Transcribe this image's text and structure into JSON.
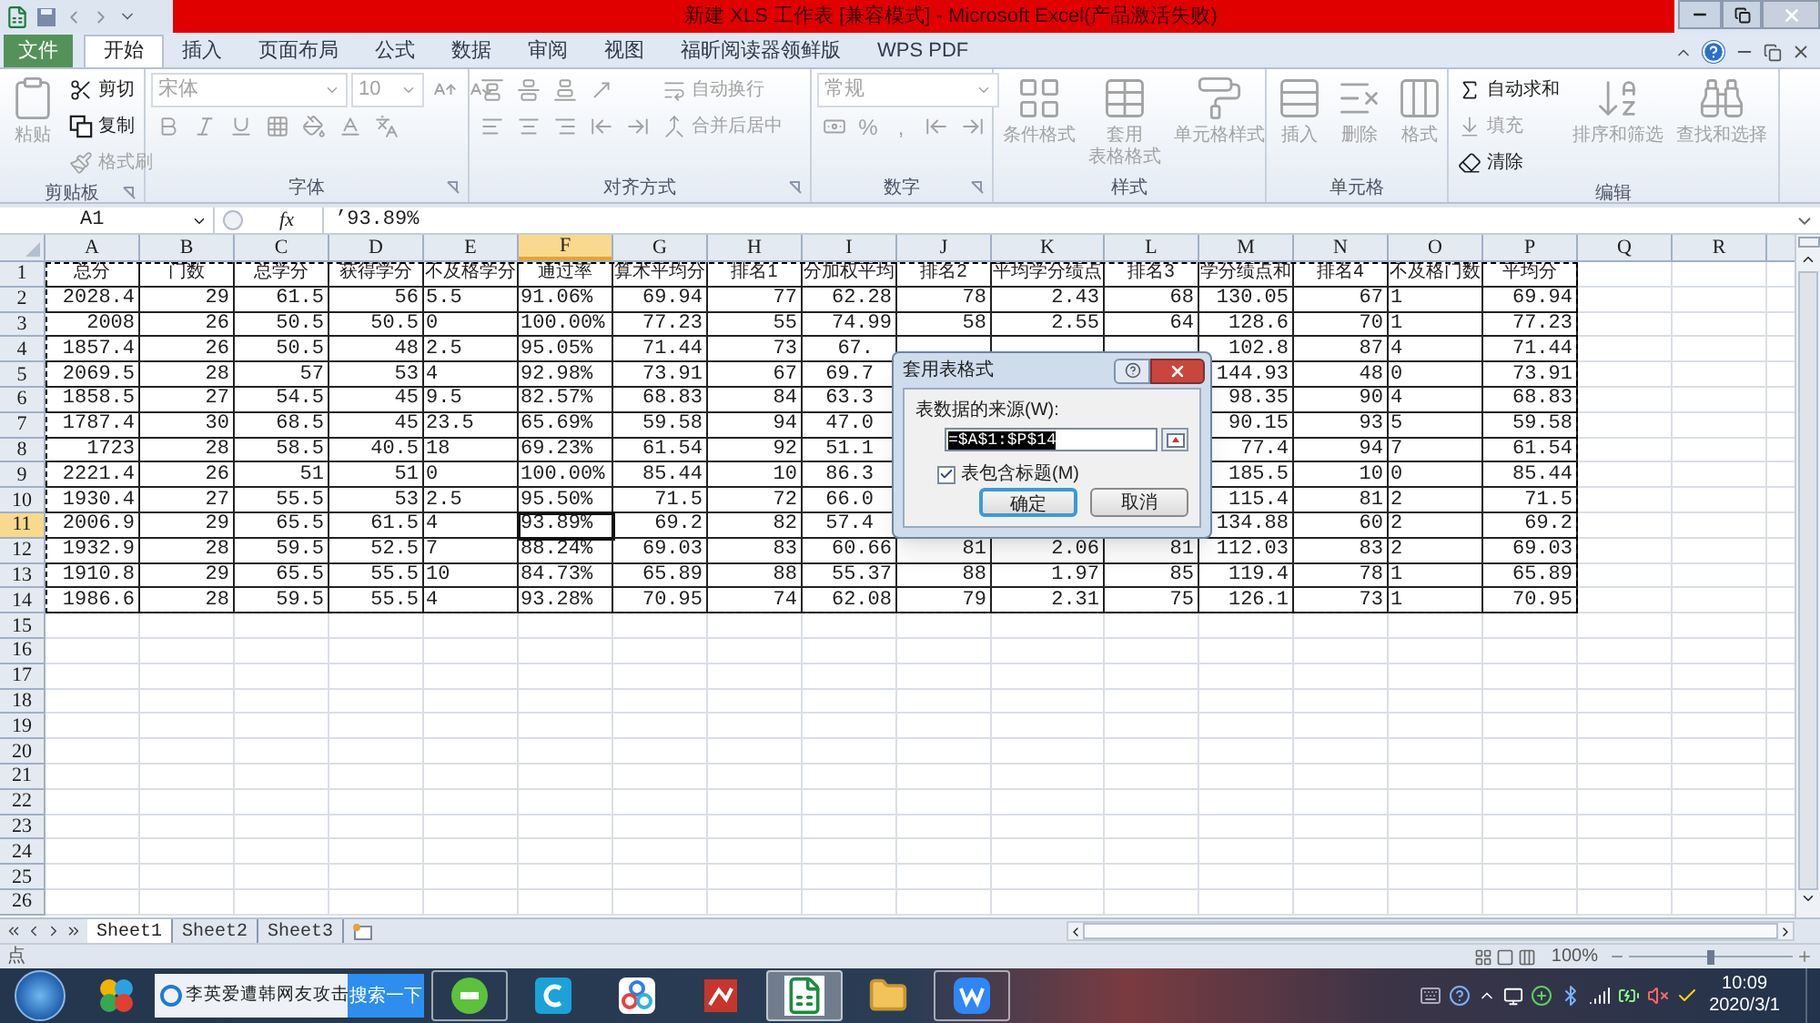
{
  "window": {
    "title": "新建 XLS 工作表 [兼容模式] - Microsoft Excel(产品激活失败)"
  },
  "ribbon": {
    "tabs": [
      {
        "label": "文件",
        "kind": "file",
        "selected": false
      },
      {
        "label": "开始",
        "kind": "tab",
        "selected": true
      },
      {
        "label": "插入",
        "kind": "tab",
        "selected": false
      },
      {
        "label": "页面布局",
        "kind": "tab",
        "selected": false
      },
      {
        "label": "公式",
        "kind": "tab",
        "selected": false
      },
      {
        "label": "数据",
        "kind": "tab",
        "selected": false
      },
      {
        "label": "审阅",
        "kind": "tab",
        "selected": false
      },
      {
        "label": "视图",
        "kind": "tab",
        "selected": false
      },
      {
        "label": "福昕阅读器领鲜版",
        "kind": "tab",
        "selected": false
      },
      {
        "label": "WPS PDF",
        "kind": "tab",
        "selected": false
      }
    ],
    "groups": [
      {
        "title": "剪贴板",
        "launcher": true,
        "columns": [
          {
            "rows": [
              [
                {
                  "kind": "large",
                  "label": "粘贴",
                  "disabled": true
                }
              ]
            ]
          },
          {
            "rows": [
              [
                {
                  "kind": "small",
                  "label": "剪切",
                  "disabled": false
                }
              ],
              [
                {
                  "kind": "small",
                  "label": "复制",
                  "disabled": false
                }
              ],
              [
                {
                  "kind": "small",
                  "label": "格式刷",
                  "disabled": true
                }
              ]
            ]
          }
        ]
      },
      {
        "title": "字体",
        "launcher": true,
        "columns": [
          {
            "rows": [
              [
                {
                  "kind": "combo",
                  "placeholder": "宋体",
                  "disabled": true
                },
                {
                  "kind": "combo",
                  "placeholder": "10",
                  "disabled": true
                },
                {
                  "kind": "icon",
                  "disabled": true
                },
                {
                  "kind": "icon",
                  "disabled": true
                }
              ],
              [
                {
                  "kind": "icon",
                  "disabled": true
                },
                {
                  "kind": "icon",
                  "disabled": true
                },
                {
                  "kind": "icon",
                  "disabled": true
                },
                {
                  "kind": "icon",
                  "disabled": true
                },
                {
                  "kind": "icon",
                  "disabled": true
                },
                {
                  "kind": "icon",
                  "disabled": true
                },
                {
                  "kind": "icon",
                  "disabled": true
                }
              ]
            ]
          }
        ]
      },
      {
        "title": "对齐方式",
        "launcher": true,
        "columns": [
          {
            "rows": [
              [
                {
                  "kind": "icon",
                  "disabled": true
                },
                {
                  "kind": "icon",
                  "disabled": true
                },
                {
                  "kind": "icon",
                  "disabled": true
                },
                {
                  "kind": "icon",
                  "disabled": true
                }
              ],
              [
                {
                  "kind": "icon",
                  "disabled": true
                },
                {
                  "kind": "icon",
                  "disabled": true
                },
                {
                  "kind": "icon",
                  "disabled": true
                },
                {
                  "kind": "icon",
                  "disabled": true
                },
                {
                  "kind": "icon",
                  "disabled": true
                }
              ]
            ]
          },
          {
            "rows": [
              [
                {
                  "kind": "small",
                  "label": "自动换行",
                  "disabled": true
                }
              ],
              [
                {
                  "kind": "small",
                  "label": "合并后居中",
                  "disabled": true
                }
              ]
            ]
          }
        ]
      },
      {
        "title": "数字",
        "launcher": true,
        "columns": [
          {
            "rows": [
              [
                {
                  "kind": "combo",
                  "placeholder": "常规",
                  "disabled": true
                }
              ],
              [
                {
                  "kind": "icon",
                  "disabled": true
                },
                {
                  "kind": "glyph",
                  "label": "%",
                  "disabled": true
                },
                {
                  "kind": "glyph",
                  "label": ",",
                  "disabled": true
                },
                {
                  "kind": "icon",
                  "disabled": true
                },
                {
                  "kind": "icon",
                  "disabled": true
                }
              ]
            ]
          }
        ]
      },
      {
        "title": "样式",
        "launcher": false,
        "columns": [
          {
            "rows": [
              [
                {
                  "kind": "large",
                  "label": "条件格式",
                  "disabled": true
                }
              ]
            ]
          },
          {
            "rows": [
              [
                {
                  "kind": "large",
                  "lines": [
                    "套用",
                    "表格格式"
                  ],
                  "disabled": true
                }
              ]
            ]
          },
          {
            "rows": [
              [
                {
                  "kind": "large",
                  "label": "单元格样式",
                  "disabled": true
                }
              ]
            ]
          }
        ]
      },
      {
        "title": "单元格",
        "launcher": false,
        "columns": [
          {
            "rows": [
              [
                {
                  "kind": "large",
                  "label": "插入",
                  "disabled": true
                }
              ]
            ]
          },
          {
            "rows": [
              [
                {
                  "kind": "large",
                  "label": "删除",
                  "disabled": true
                }
              ]
            ]
          },
          {
            "rows": [
              [
                {
                  "kind": "large",
                  "label": "格式",
                  "disabled": true
                }
              ]
            ]
          }
        ]
      },
      {
        "title": "编辑",
        "launcher": false,
        "columns": [
          {
            "rows": [
              [
                {
                  "kind": "small",
                  "label": "自动求和",
                  "disabled": false
                }
              ],
              [
                {
                  "kind": "small",
                  "label": "填充",
                  "disabled": true
                }
              ],
              [
                {
                  "kind": "small",
                  "label": "清除",
                  "disabled": false
                }
              ]
            ]
          },
          {
            "rows": [
              [
                {
                  "kind": "large",
                  "label": "排序和筛选",
                  "disabled": true
                }
              ]
            ]
          },
          {
            "rows": [
              [
                {
                  "kind": "large",
                  "label": "查找和选择",
                  "disabled": true
                }
              ]
            ]
          }
        ]
      }
    ]
  },
  "formula_bar": {
    "name_box": "A1",
    "fx": "fx",
    "formula": "’93.89%"
  },
  "sheet": {
    "copy_marquee": true,
    "columns": [
      {
        "letter": "A",
        "left_aligned": false,
        "selected": false
      },
      {
        "letter": "B",
        "left_aligned": false,
        "selected": false
      },
      {
        "letter": "C",
        "left_aligned": false,
        "selected": false
      },
      {
        "letter": "D",
        "left_aligned": false,
        "selected": false
      },
      {
        "letter": "E",
        "left_aligned": true,
        "selected": false
      },
      {
        "letter": "F",
        "left_aligned": true,
        "selected": true
      },
      {
        "letter": "G",
        "left_aligned": false,
        "selected": false
      },
      {
        "letter": "H",
        "left_aligned": false,
        "selected": false
      },
      {
        "letter": "I",
        "left_aligned": false,
        "selected": false
      },
      {
        "letter": "J",
        "left_aligned": false,
        "selected": false
      },
      {
        "letter": "K",
        "left_aligned": false,
        "selected": false
      },
      {
        "letter": "L",
        "left_aligned": false,
        "selected": false
      },
      {
        "letter": "M",
        "left_aligned": false,
        "selected": false
      },
      {
        "letter": "N",
        "left_aligned": false,
        "selected": false
      },
      {
        "letter": "O",
        "left_aligned": true,
        "selected": false
      },
      {
        "letter": "P",
        "left_aligned": false,
        "selected": false
      },
      {
        "letter": "Q",
        "selected": false
      },
      {
        "letter": "R",
        "selected": false
      }
    ],
    "rows": [
      {
        "header": "1",
        "kind": "heading",
        "selected": false,
        "cells": [
          "总分",
          "门数",
          "总学分",
          "获得学分",
          "不及格学分",
          "通过率",
          "算术平均分",
          "排名1",
          "分加权平均",
          "排名2",
          "平均学分绩点",
          "排名3",
          "学分绩点和",
          "排名4",
          "不及格门数",
          "平均分"
        ]
      },
      {
        "header": "2",
        "kind": "data",
        "selected": false,
        "cells": [
          "2028.4",
          "29",
          "61.5",
          "56",
          "5.5",
          "91.06%",
          "69.94",
          "77",
          "62.28",
          "78",
          "2.43",
          "68",
          "130.05",
          "67",
          "1",
          "69.94"
        ]
      },
      {
        "header": "3",
        "kind": "data",
        "selected": false,
        "cells": [
          "2008",
          "26",
          "50.5",
          "50.5",
          "0",
          "100.00%",
          "77.23",
          "55",
          "74.99",
          "58",
          "2.55",
          "64",
          "128.6",
          "70",
          "1",
          "77.23"
        ]
      },
      {
        "header": "4",
        "kind": "data",
        "selected": false,
        "cells": [
          "1857.4",
          "26",
          "50.5",
          "48",
          "2.5",
          "95.05%",
          "71.44",
          "73",
          {
            "text": "67.",
            "clipped": true
          },
          null,
          null,
          null,
          "102.8",
          "87",
          "4",
          "71.44"
        ]
      },
      {
        "header": "5",
        "kind": "data",
        "selected": false,
        "cells": [
          "2069.5",
          "28",
          "57",
          "53",
          "4",
          "92.98%",
          "73.91",
          "67",
          {
            "text": "69.7",
            "clipped": true
          },
          null,
          null,
          null,
          "144.93",
          "48",
          "0",
          "73.91"
        ]
      },
      {
        "header": "6",
        "kind": "data",
        "selected": false,
        "cells": [
          "1858.5",
          "27",
          "54.5",
          "45",
          "9.5",
          "82.57%",
          "68.83",
          "84",
          {
            "text": "63.3",
            "clipped": true
          },
          null,
          null,
          null,
          "98.35",
          "90",
          "4",
          "68.83"
        ]
      },
      {
        "header": "7",
        "kind": "data",
        "selected": false,
        "cells": [
          "1787.4",
          "30",
          "68.5",
          "45",
          "23.5",
          "65.69%",
          "59.58",
          "94",
          {
            "text": "47.0",
            "clipped": true
          },
          null,
          null,
          null,
          "90.15",
          "93",
          "5",
          "59.58"
        ]
      },
      {
        "header": "8",
        "kind": "data",
        "selected": false,
        "cells": [
          "1723",
          "28",
          "58.5",
          "40.5",
          "18",
          "69.23%",
          "61.54",
          "92",
          {
            "text": "51.1",
            "clipped": true
          },
          null,
          null,
          null,
          "77.4",
          "94",
          "7",
          "61.54"
        ]
      },
      {
        "header": "9",
        "kind": "data",
        "selected": false,
        "cells": [
          "2221.4",
          "26",
          "51",
          "51",
          "0",
          "100.00%",
          "85.44",
          "10",
          {
            "text": "86.3",
            "clipped": true
          },
          null,
          null,
          null,
          "185.5",
          "10",
          "0",
          "85.44"
        ]
      },
      {
        "header": "10",
        "kind": "data",
        "selected": false,
        "cells": [
          "1930.4",
          "27",
          "55.5",
          "53",
          "2.5",
          "95.50%",
          "71.5",
          "72",
          {
            "text": "66.0",
            "clipped": true
          },
          null,
          null,
          null,
          "115.4",
          "81",
          "2",
          "71.5"
        ]
      },
      {
        "header": "11",
        "kind": "data",
        "selected": true,
        "cells": [
          "2006.9",
          "29",
          "65.5",
          "61.5",
          "4",
          "93.89%",
          "69.2",
          "82",
          {
            "text": "57.4",
            "clipped": true
          },
          null,
          null,
          null,
          "134.88",
          "60",
          "2",
          "69.2"
        ]
      },
      {
        "header": "12",
        "kind": "data",
        "selected": false,
        "cells": [
          "1932.9",
          "28",
          "59.5",
          "52.5",
          "7",
          "88.24%",
          "69.03",
          "83",
          "60.66",
          "81",
          "2.06",
          "81",
          "112.03",
          "83",
          "2",
          "69.03"
        ]
      },
      {
        "header": "13",
        "kind": "data",
        "selected": false,
        "cells": [
          "1910.8",
          "29",
          "65.5",
          "55.5",
          "10",
          "84.73%",
          "65.89",
          "88",
          "55.37",
          "88",
          "1.97",
          "85",
          "119.4",
          "78",
          "1",
          "65.89"
        ]
      },
      {
        "header": "14",
        "kind": "data",
        "selected": false,
        "cells": [
          "1986.6",
          "28",
          "59.5",
          "55.5",
          "4",
          "93.28%",
          "70.95",
          "74",
          "62.08",
          "79",
          "2.31",
          "75",
          "126.1",
          "73",
          "1",
          "70.95"
        ]
      },
      {
        "header": "15",
        "selected": false
      },
      {
        "header": "16",
        "selected": false
      },
      {
        "header": "17",
        "selected": false
      },
      {
        "header": "18",
        "selected": false
      },
      {
        "header": "19",
        "selected": false
      },
      {
        "header": "20",
        "selected": false
      },
      {
        "header": "21",
        "selected": false
      },
      {
        "header": "22",
        "selected": false
      },
      {
        "header": "23",
        "selected": false
      },
      {
        "header": "24",
        "selected": false
      },
      {
        "header": "25",
        "selected": false
      },
      {
        "header": "26",
        "selected": false
      }
    ],
    "sheet_tabs": [
      {
        "label": "Sheet1",
        "selected": true
      },
      {
        "label": "Sheet2",
        "selected": false
      },
      {
        "label": "Sheet3",
        "selected": false
      }
    ]
  },
  "dialog": {
    "title": "套用表格式",
    "label": "表数据的来源(W):",
    "value": "=$A$1:$P$14",
    "value_selected": true,
    "checkbox": {
      "label": "表包含标题(M)",
      "checked": true
    },
    "buttons": [
      {
        "label": "确定",
        "default": true
      },
      {
        "label": "取消",
        "default": false
      }
    ]
  },
  "status_bar": {
    "mode": "点",
    "zoom": "100%",
    "zoom_slider": {
      "level": 0.5
    }
  },
  "taskbar": {
    "pinned": [
      {
        "selected": false,
        "running": false
      }
    ],
    "search": {
      "text": "李英爱遭韩网友攻击",
      "button": "搜索一下"
    },
    "apps": [
      {
        "selected": false,
        "running": true
      },
      {
        "selected": false,
        "running": false
      },
      {
        "selected": false,
        "running": false
      },
      {
        "selected": false,
        "running": false
      },
      {
        "selected": true,
        "running": true
      },
      {
        "selected": false,
        "running": false
      },
      {
        "selected": false,
        "running": true
      }
    ],
    "clock": {
      "time": "10:09",
      "date": "2020/3/1"
    }
  }
}
